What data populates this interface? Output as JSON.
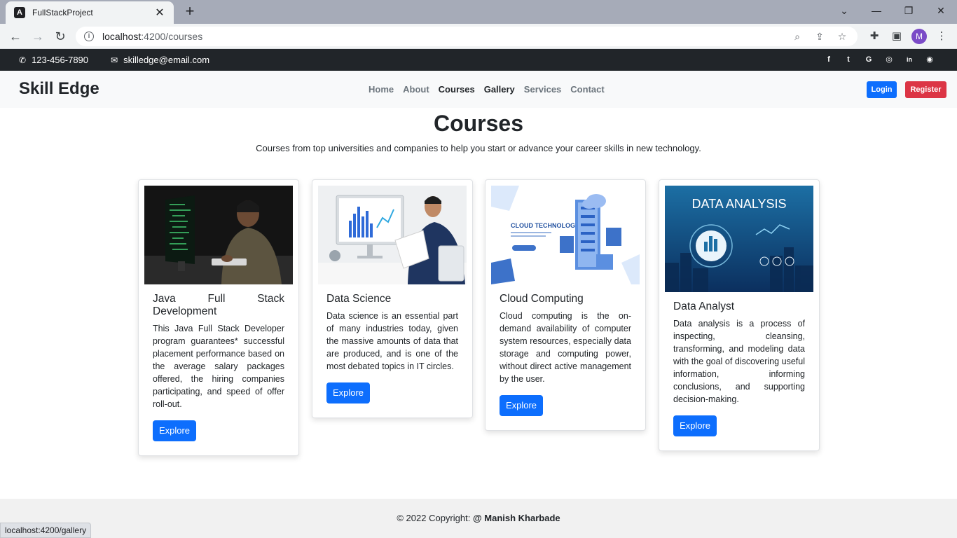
{
  "browser": {
    "tab_title": "FullStackProject",
    "tab_favicon_letter": "A",
    "url_host": "localhost",
    "url_rest": ":4200/courses",
    "profile_initial": "M",
    "status_url": "localhost:4200/gallery"
  },
  "infobar": {
    "phone": "123-456-7890",
    "email": "skilledge@email.com",
    "social_icons": [
      "facebook-icon",
      "twitter-icon",
      "google-icon",
      "instagram-icon",
      "linkedin-icon",
      "github-icon"
    ],
    "social_glyphs": [
      "f",
      "t",
      "G",
      "◎",
      "in",
      "◉"
    ]
  },
  "navbar": {
    "brand": "Skill Edge",
    "links": [
      "Home",
      "About",
      "Courses",
      "Gallery",
      "Services",
      "Contact"
    ],
    "login_label": "Login",
    "register_label": "Register"
  },
  "page": {
    "title": "Courses",
    "subtitle": "Courses from top universities and companies to help you start or advance your career skills in new technology."
  },
  "courses": [
    {
      "title": "Java Full Stack Development",
      "text": "This Java Full Stack Developer program guarantees* successful placement performance based on the average salary packages offered, the hiring companies participating, and speed of offer roll-out.",
      "button": "Explore"
    },
    {
      "title": "Data Science",
      "text": "Data science is an essential part of many industries today, given the massive amounts of data that are produced, and is one of the most debated topics in IT circles.",
      "button": "Explore"
    },
    {
      "title": "Cloud Computing",
      "text": "Cloud computing is the on-demand availability of computer system resources, especially data storage and computing power, without direct active management by the user.",
      "button": "Explore",
      "image_text": "CLOUD TECHNOLOGY"
    },
    {
      "title": "Data Analyst",
      "text": "Data analysis is a process of inspecting, cleansing, transforming, and modeling data with the goal of discovering useful information, informing conclusions, and supporting decision-making.",
      "button": "Explore",
      "image_text": "DATA ANALYSIS"
    }
  ],
  "footer": {
    "prefix": "© 2022 Copyright:",
    "author": "@ Manish Kharbade"
  },
  "colors": {
    "primary": "#0d6efd",
    "danger": "#dc3545",
    "dark": "#212529"
  }
}
